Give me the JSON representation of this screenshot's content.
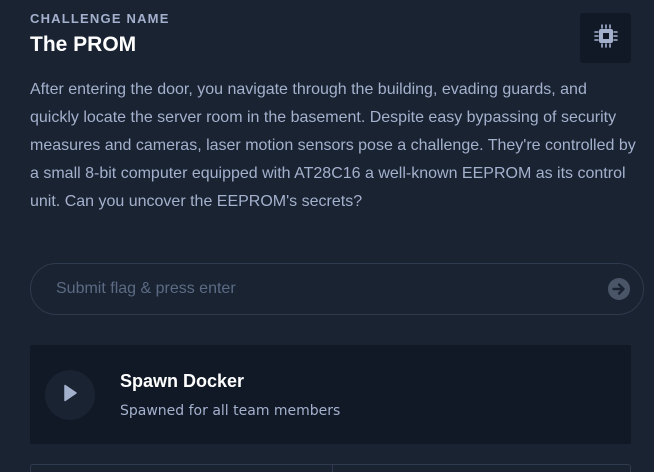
{
  "challenge": {
    "label": "CHALLENGE NAME",
    "title": "The PROM",
    "description": "After entering the door, you navigate through the building, evading guards, and quickly locate the server room in the basement. Despite easy bypassing of security measures and cameras, laser motion sensors pose a challenge. They're controlled by a small 8-bit computer equipped with AT28C16 a well-known EEPROM as its control unit. Can you uncover the EEPROM's secrets?",
    "category_icon": "chip-icon"
  },
  "flag": {
    "placeholder": "Submit flag & press enter",
    "value": "",
    "submit_icon": "arrow-right-circle-icon"
  },
  "docker": {
    "title": "Spawn Docker",
    "subtitle": "Spawned for all team members",
    "icon": "play-icon"
  },
  "colors": {
    "background": "#1a2332",
    "card": "#111927",
    "text_primary": "#ffffff",
    "text_secondary": "#a4b1cd",
    "border": "#2e3a4d"
  }
}
